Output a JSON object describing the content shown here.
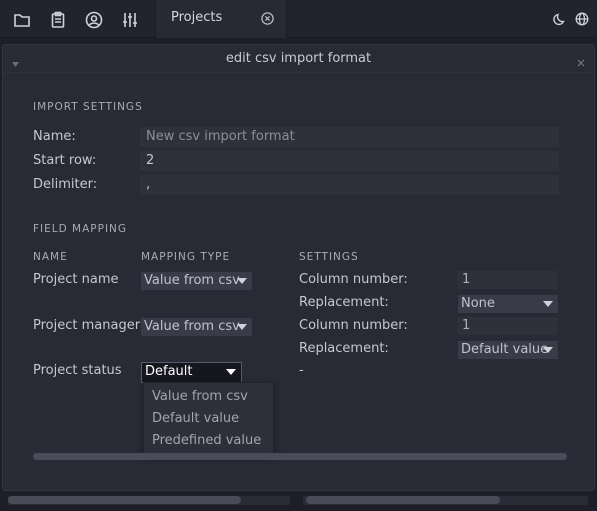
{
  "tab": {
    "label": "Projects"
  },
  "dialog": {
    "title": "edit csv import format",
    "import_settings": {
      "section_title": "IMPORT SETTINGS",
      "name_label": "Name:",
      "name_placeholder": "New csv import format",
      "start_row_label": "Start row:",
      "start_row_value": "2",
      "delimiter_label": "Delimiter:",
      "delimiter_value": ","
    },
    "field_mapping": {
      "section_title": "FIELD MAPPING",
      "headers": {
        "name": "NAME",
        "mapping_type": "MAPPING TYPE",
        "settings": "SETTINGS"
      },
      "rows": [
        {
          "name": "Project name",
          "mapping_type": "Value from csv",
          "settings": [
            {
              "label": "Column number:",
              "value": "1"
            },
            {
              "label": "Replacement:",
              "value": "None"
            }
          ]
        },
        {
          "name": "Project manager",
          "mapping_type": "Value from csv",
          "settings": [
            {
              "label": "Column number:",
              "value": "1"
            },
            {
              "label": "Replacement:",
              "value": "Default value"
            }
          ]
        },
        {
          "name": "Project status",
          "mapping_type": "Default",
          "settings_text": "-"
        }
      ],
      "dropdown_options": [
        "Value from csv",
        "Default value",
        "Predefined value"
      ]
    }
  },
  "icons": {
    "toolbar": [
      "folder-icon",
      "clipboard-icon",
      "user-circle-icon",
      "sliders-icon"
    ],
    "right": [
      "moon-icon",
      "globe-icon"
    ]
  }
}
